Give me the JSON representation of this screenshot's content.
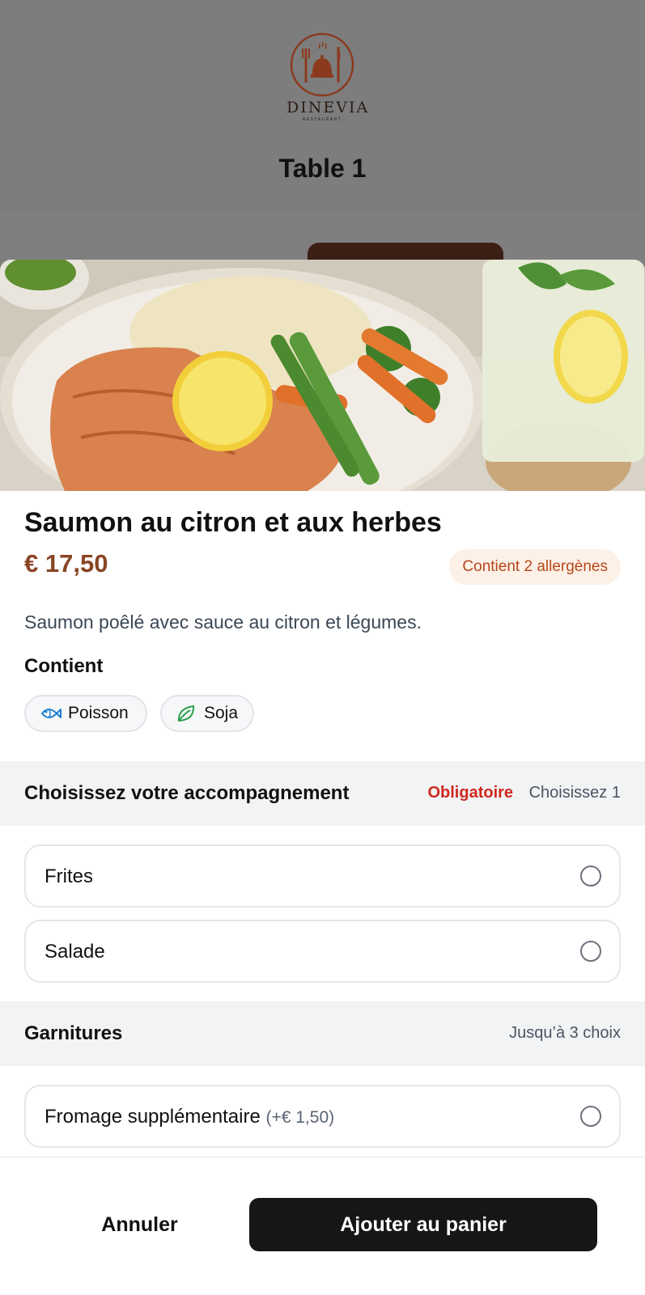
{
  "brand": {
    "name": "DINEVIA",
    "sub": "RESTAURANT",
    "color": "#8b3a1e"
  },
  "header": {
    "table_title": "Table 1"
  },
  "item": {
    "title": "Saumon au citron et aux herbes",
    "price": "€ 17,50",
    "allergen_badge": "Contient 2 allergènes",
    "description": "Saumon poêlé avec sauce au citron et légumes.",
    "contains_label": "Contient",
    "allergens": [
      {
        "label": "Poisson",
        "icon": "fish-icon",
        "color": "#1f7fd1"
      },
      {
        "label": "Soja",
        "icon": "leaf-icon",
        "color": "#2aa04a"
      }
    ]
  },
  "sections": {
    "side": {
      "title": "Choisissez votre accompagnement",
      "required": "Obligatoire",
      "hint": "Choisissez 1",
      "options": [
        {
          "label": "Frites"
        },
        {
          "label": "Salade"
        }
      ]
    },
    "toppings": {
      "title": "Garnitures",
      "hint": "Jusqu’à 3 choix",
      "options": [
        {
          "label": "Fromage supplémentaire",
          "extra": "(+€ 1,50)"
        }
      ]
    }
  },
  "footer": {
    "cancel_label": "Annuler",
    "add_label": "Ajouter au panier"
  }
}
